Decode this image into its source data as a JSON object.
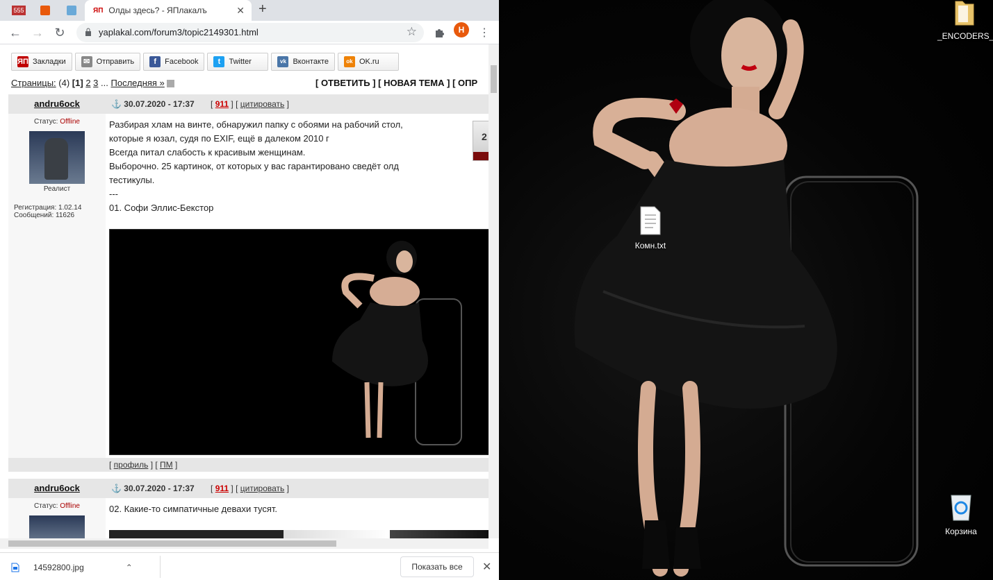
{
  "browser": {
    "pinned_tabs": [
      {
        "label": "555"
      },
      {
        "label": ""
      },
      {
        "label": ""
      }
    ],
    "active_tab": {
      "favicon": "ЯП",
      "title": "Олды здесь? - ЯПлакалъ"
    },
    "url": "yaplakal.com/forum3/topic2149301.html",
    "profile_initial": "H"
  },
  "share": [
    {
      "icon_text": "ЯП",
      "label": "Закладки",
      "color": "#c00000"
    },
    {
      "icon_text": "✉",
      "label": "Отправить",
      "color": "#888888"
    },
    {
      "icon_text": "f",
      "label": "Facebook",
      "color": "#3b5998"
    },
    {
      "icon_text": "t",
      "label": "Twitter",
      "color": "#1da1f2"
    },
    {
      "icon_text": "vk",
      "label": "Вконтакте",
      "color": "#4a76a8"
    },
    {
      "icon_text": "ok",
      "label": "OK.ru",
      "color": "#ee8208"
    }
  ],
  "pages": {
    "label": "Страницы:",
    "count": "(4)",
    "current": "[1]",
    "p2": "2",
    "p3": "3",
    "ellipsis": "...",
    "last": "Последняя »"
  },
  "actions": "[ ОТВЕТИТЬ ] [ НОВАЯ ТЕМА ] [ ОПР",
  "posts": [
    {
      "author": "andru6ock",
      "date": "30.07.2020 - 17:37",
      "rating": "911",
      "quote": "цитировать",
      "status_label": "Статус:",
      "status": "Offline",
      "rank": "Реалист",
      "reg": "Регистрация: 1.02.14",
      "messages": "Сообщений: 11626",
      "lines": [
        "Разбирая хлам на винте, обнаружил папку с обоями на рабочий стол,",
        "которые я юзал, судя по EXIF, ещё в далеком 2010 г",
        "Всегда питал слабость к красивым женщинам.",
        "Выборочно. 25 картинок, от которых у вас гарантировано сведёт олд",
        "тестикулы.",
        "---",
        "01. Софи Эллис-Бекстор"
      ],
      "vote": "2",
      "footer_profile": "профиль",
      "footer_pm": "ПМ"
    },
    {
      "author": "andru6ock",
      "date": "30.07.2020 - 17:37",
      "rating": "911",
      "quote": "цитировать",
      "status_label": "Статус:",
      "status": "Offline",
      "lines": [
        "02. Какие-то симпатичные девахи тусят."
      ]
    }
  ],
  "download": {
    "file": "14592800.jpg",
    "show_all": "Показать все"
  },
  "desktop": {
    "icons": [
      {
        "label": "_ENCODERS_",
        "icon": "folder-icon"
      },
      {
        "label": "Комн.txt",
        "icon": "text-file-icon"
      },
      {
        "label": "Корзина",
        "icon": "recycle-bin-icon"
      }
    ]
  }
}
